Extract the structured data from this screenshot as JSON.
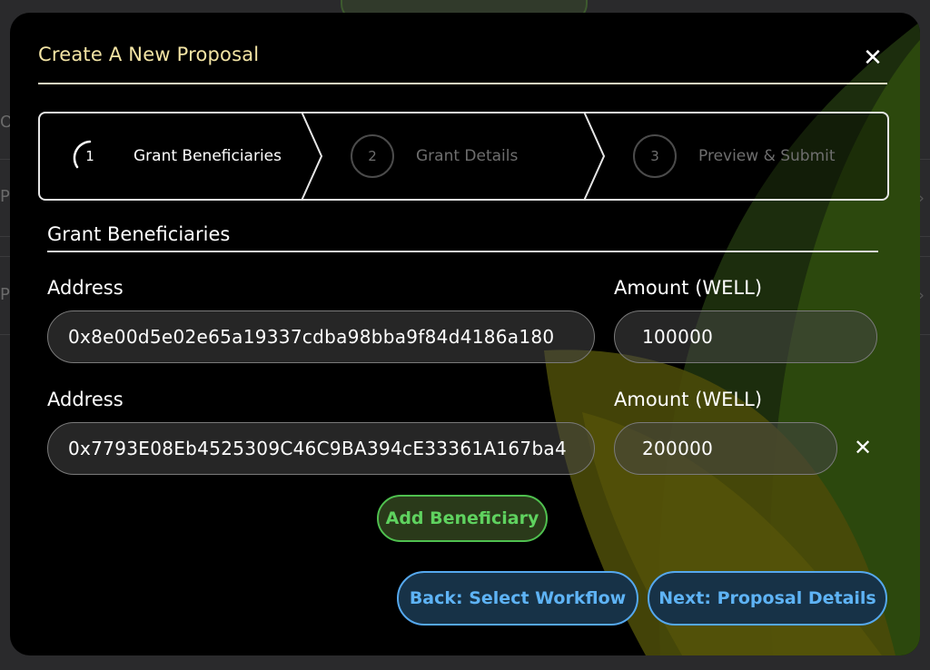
{
  "background": {
    "side_letters": [
      "O",
      "P",
      "P"
    ]
  },
  "modal": {
    "title": "Create A New Proposal",
    "close_icon": "✕"
  },
  "stepper": {
    "steps": [
      {
        "number": "1",
        "label": "Grant Beneficiaries",
        "state": "active"
      },
      {
        "number": "2",
        "label": "Grant Details",
        "state": "inactive"
      },
      {
        "number": "3",
        "label": "Preview & Submit",
        "state": "inactive"
      }
    ]
  },
  "section": {
    "title": "Grant Beneficiaries"
  },
  "beneficiaries": [
    {
      "address_label": "Address",
      "address_value": "0x8e00d5e02e65a19337cdba98bba9f84d4186a180",
      "amount_label": "Amount (WELL)",
      "amount_value": "100000"
    },
    {
      "address_label": "Address",
      "address_value": "0x7793E08Eb4525309C46C9BA394cE33361A167ba4",
      "amount_label": "Amount (WELL)",
      "amount_value": "200000",
      "remove_icon": "✕"
    }
  ],
  "buttons": {
    "add_beneficiary": "Add Beneficiary",
    "back": "Back: Select Workflow",
    "next": "Next: Proposal Details"
  },
  "colors": {
    "title": "#f3e4a4",
    "add_button": "#4fc04f",
    "nav_button": "#55a8ee",
    "modal_bg": "#000000"
  }
}
